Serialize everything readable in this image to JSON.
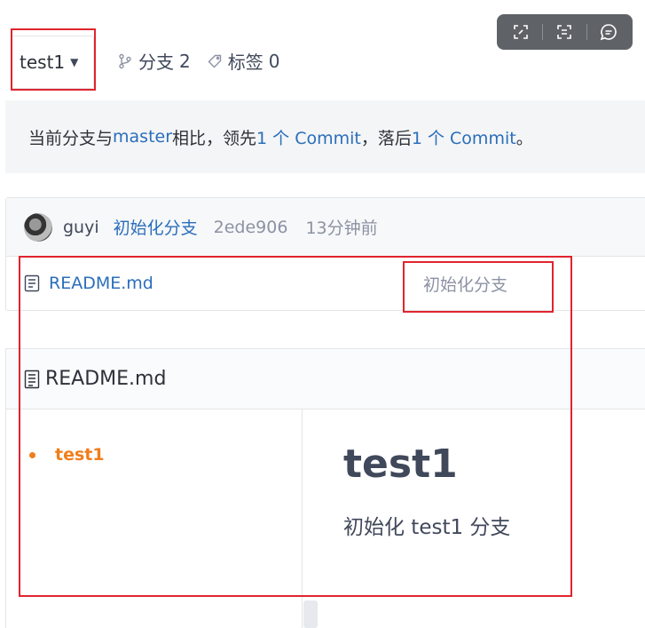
{
  "toolbar": {
    "icons": [
      "expand-icon",
      "scan-text-icon",
      "comment-icon"
    ]
  },
  "branch": {
    "current": "test1",
    "branches_label": "分支",
    "branches_count": "2",
    "tags_label": "标签",
    "tags_count": "0"
  },
  "compare": {
    "prefix": "当前分支与 ",
    "base_branch": "master",
    "middle1": " 相比，领先 ",
    "ahead": "1 个 Commit",
    "middle2": "，落后 ",
    "behind": "1 个 Commit",
    "suffix": "。"
  },
  "commit": {
    "author": "guyi",
    "message": "初始化分支",
    "hash": "2ede906",
    "time": "13分钟前"
  },
  "files": [
    {
      "name": "README.md",
      "last_commit": "初始化分支"
    }
  ],
  "readme": {
    "title": "README.md",
    "toc": [
      "test1"
    ],
    "heading": "test1",
    "paragraph": "初始化 test1 分支"
  },
  "colors": {
    "link": "#2a6ebb",
    "toc_active": "#f07e1c",
    "annotation": "#e0242e"
  }
}
